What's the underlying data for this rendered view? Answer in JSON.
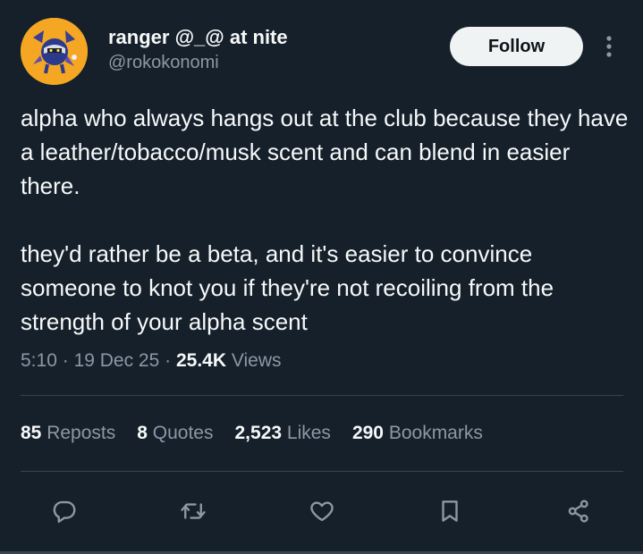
{
  "author": {
    "display_name": "ranger @_@ at nite",
    "handle": "@rokokonomi"
  },
  "follow_label": "Follow",
  "tweet": {
    "paragraphs": [
      "alpha who always hangs out at the club because they have a leather/tobacco/musk scent and can blend in easier there.",
      "they'd rather be a beta, and it's easier to convince someone to knot you if they're not recoiling from the strength of your alpha scent"
    ]
  },
  "meta": {
    "time": "5:10",
    "sep1": "·",
    "date": "19 Dec 25",
    "sep2": "·",
    "views_count": "25.4K",
    "views_label": "Views"
  },
  "stats": {
    "reposts_count": "85",
    "reposts_label": "Reposts",
    "quotes_count": "8",
    "quotes_label": "Quotes",
    "likes_count": "2,523",
    "likes_label": "Likes",
    "bookmarks_count": "290",
    "bookmarks_label": "Bookmarks"
  },
  "icons": [
    "reply-icon",
    "repost-icon",
    "like-icon",
    "bookmark-icon",
    "share-icon",
    "more-icon"
  ],
  "colors": {
    "background": "#15202b",
    "text": "#f7f9f9",
    "muted": "#8b98a5",
    "divider": "#38444d",
    "button_bg": "#eff3f4",
    "avatar_bg": "#f5a623"
  }
}
